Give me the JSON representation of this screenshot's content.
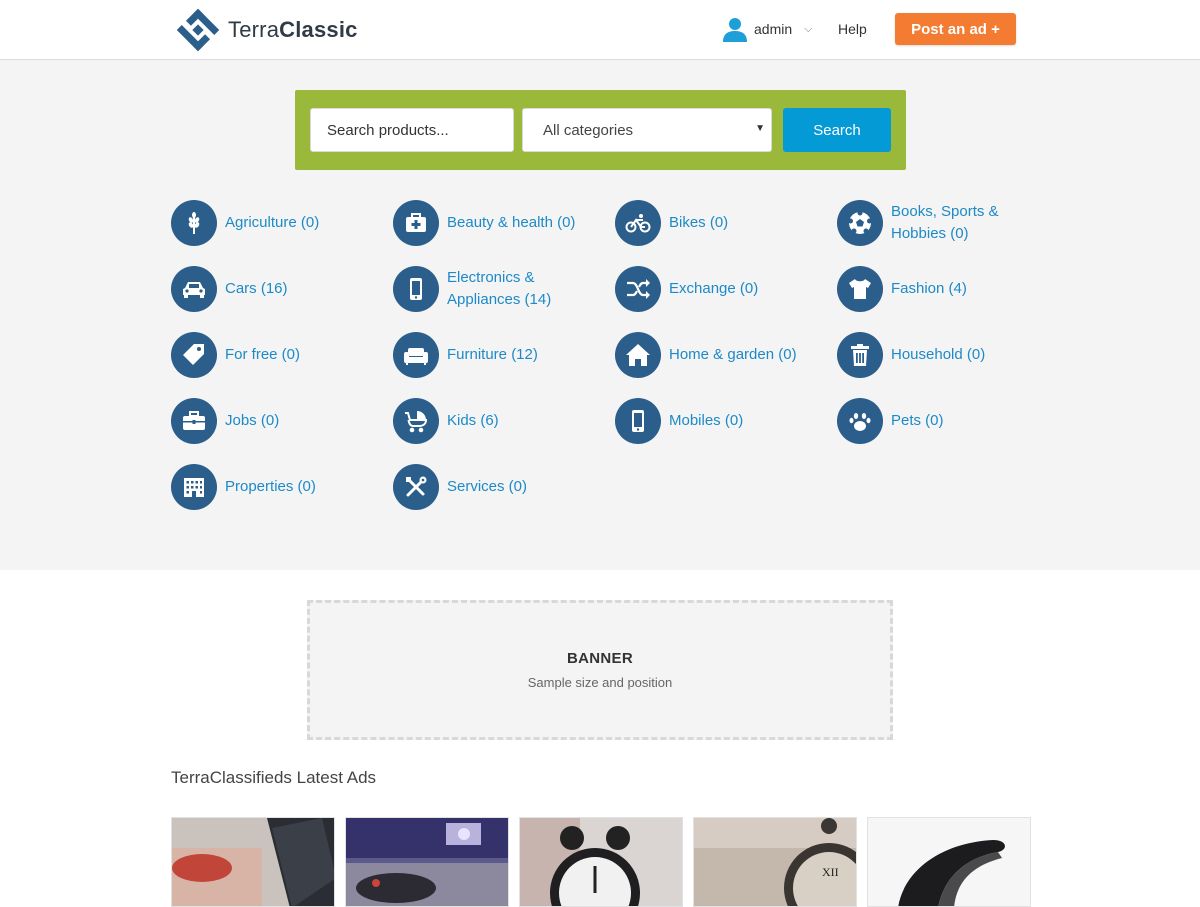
{
  "header": {
    "logo_light": "Terra",
    "logo_bold": "Classic",
    "user_name": "admin",
    "help_label": "Help",
    "post_ad_label": "Post an ad +"
  },
  "search": {
    "placeholder": "Search products...",
    "category_selected": "All categories",
    "button_label": "Search"
  },
  "categories": [
    {
      "label": "Agriculture (0)",
      "icon": "wheat-icon"
    },
    {
      "label": "Beauty & health (0)",
      "icon": "first-aid-icon"
    },
    {
      "label": "Bikes (0)",
      "icon": "bicycle-icon"
    },
    {
      "label": "Books, Sports & Hobbies (0)",
      "icon": "soccer-ball-icon"
    },
    {
      "label": "Cars (16)",
      "icon": "car-icon"
    },
    {
      "label": "Electronics & Appliances (14)",
      "icon": "smartphone-icon"
    },
    {
      "label": "Exchange (0)",
      "icon": "shuffle-icon"
    },
    {
      "label": "Fashion (4)",
      "icon": "tshirt-icon"
    },
    {
      "label": "For free (0)",
      "icon": "tag-icon"
    },
    {
      "label": "Furniture (12)",
      "icon": "sofa-icon"
    },
    {
      "label": "Home & garden (0)",
      "icon": "home-icon"
    },
    {
      "label": "Household (0)",
      "icon": "trash-icon"
    },
    {
      "label": "Jobs (0)",
      "icon": "briefcase-icon"
    },
    {
      "label": "Kids (6)",
      "icon": "stroller-icon"
    },
    {
      "label": "Mobiles (0)",
      "icon": "mobile-icon"
    },
    {
      "label": "Pets (0)",
      "icon": "paw-icon"
    },
    {
      "label": "Properties (0)",
      "icon": "building-icon"
    },
    {
      "label": "Services (0)",
      "icon": "tools-icon"
    }
  ],
  "banner": {
    "title": "BANNER",
    "subtitle": "Sample size and position"
  },
  "latest": {
    "title": "TerraClassifieds Latest Ads",
    "thumbnails": [
      "laptop-photo",
      "electronics-photo",
      "alarm-clock-photo",
      "clock-photo",
      "chair-photo"
    ]
  },
  "colors": {
    "accent_orange": "#f47b32",
    "search_bar_green": "#9ab83a",
    "search_button_blue": "#039ad6",
    "category_icon_blue": "#2b5e8a",
    "link_blue": "#1d8ac7"
  }
}
